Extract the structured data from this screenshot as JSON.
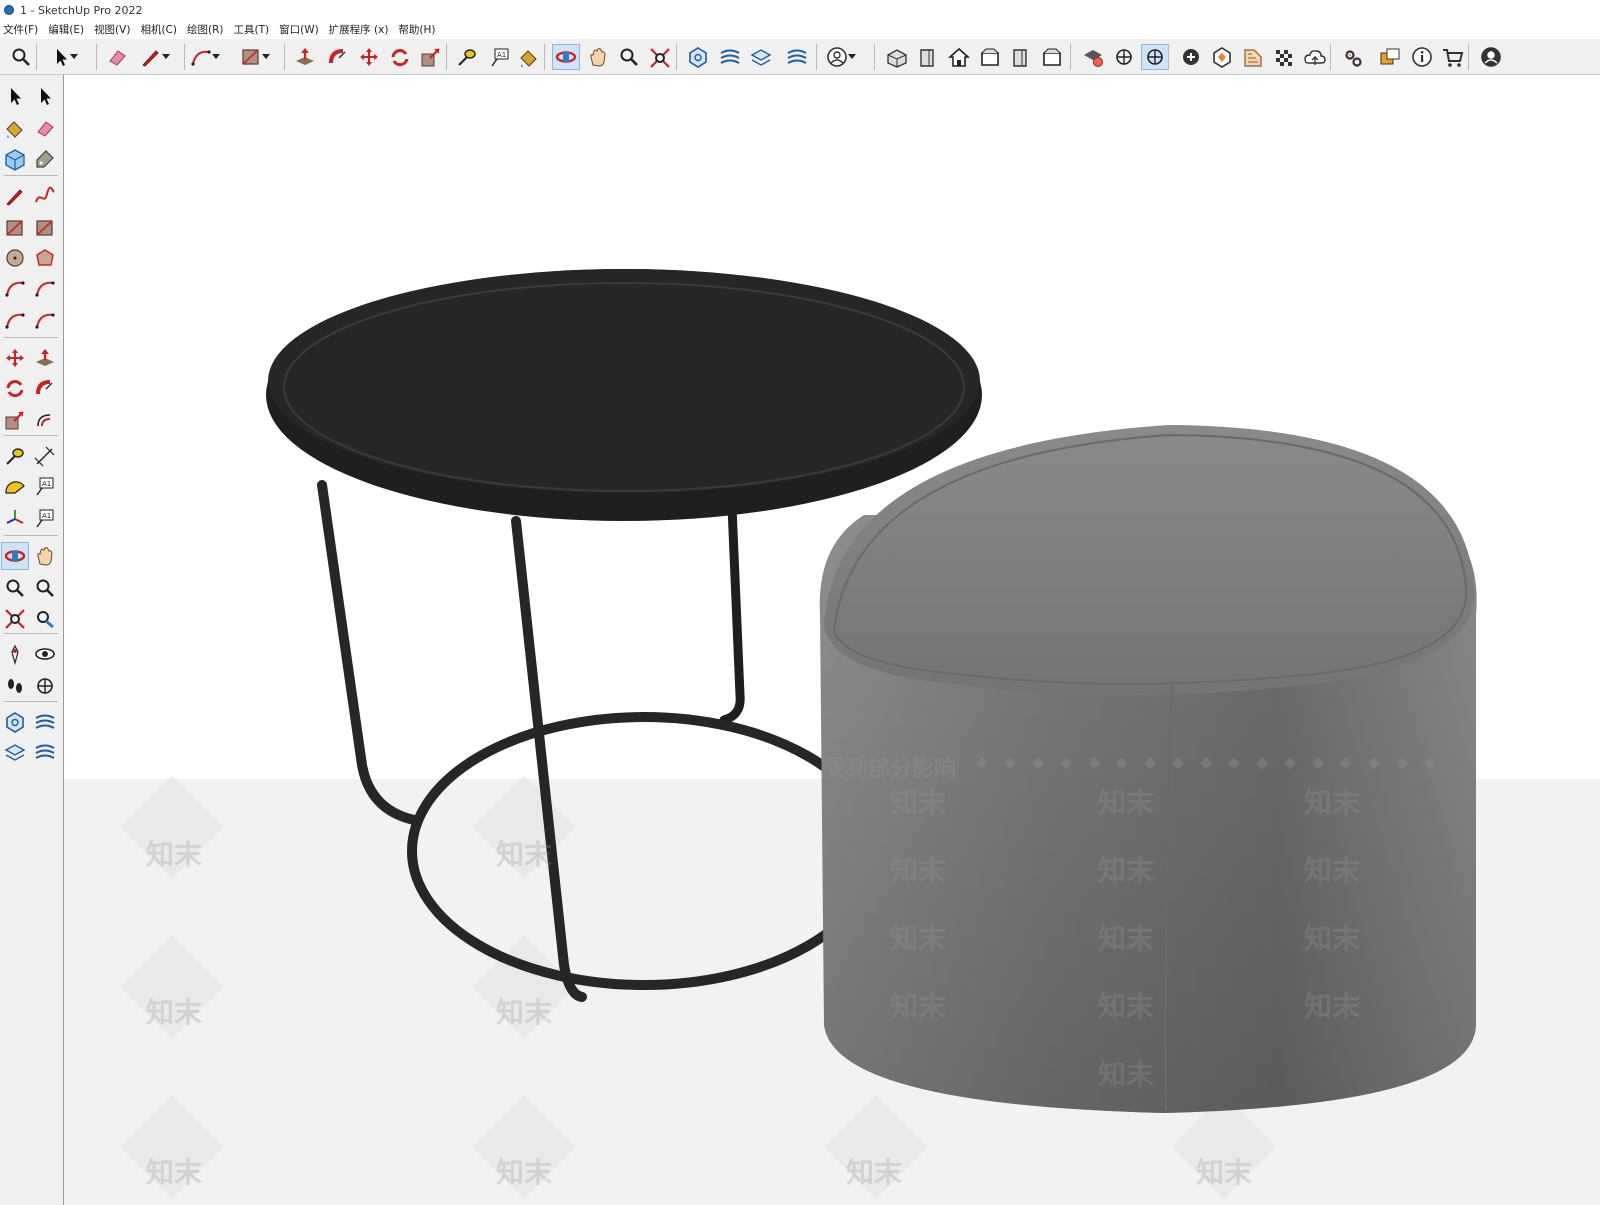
{
  "window": {
    "title": "1 - SketchUp Pro 2022"
  },
  "menu": [
    "文件(F)",
    "编辑(E)",
    "视图(V)",
    "相机(C)",
    "绘图(R)",
    "工具(T)",
    "窗口(W)",
    "扩展程序 (x)",
    "帮助(H)"
  ],
  "colors": {
    "toolbar_bg": "#f0f0f0",
    "table_black": "#262626",
    "ottoman_gray": "#7a7a7a",
    "ground": "#f2f2f2",
    "active_tool": "#cfe3f7"
  },
  "top_toolbar": [
    "search-icon",
    "select-icon",
    "eraser-icon",
    "pencil-line-icon",
    "arc-icon",
    "rectangle-icon",
    "push-pull-icon",
    "follow-me-icon",
    "move-icon",
    "rotate-icon",
    "scale-icon",
    "tape-measure-icon",
    "text-label-icon",
    "paint-bucket-icon",
    "orbit-icon",
    "pan-icon",
    "zoom-icon",
    "zoom-extents-icon",
    "warehouse-icon",
    "extension-warehouse-icon",
    "layout-icon",
    "extension-manager-icon",
    "user-account-icon",
    "iso-view-icon",
    "front-view-icon",
    "home-view-icon",
    "top-view-icon",
    "right-view-icon",
    "back-view-icon",
    "solid-check-icon",
    "section-plane-icon",
    "section-cut-icon",
    "add-location-icon",
    "sandbox-icon",
    "style-builder-icon",
    "checker-icon",
    "cloud-icon",
    "settings-icon",
    "dialog-icon",
    "info-icon",
    "cart-icon",
    "profile-icon"
  ],
  "left_toolbar": [
    "select-icon",
    "orbit-select-icon",
    "paint-bucket-icon",
    "eraser-icon",
    "component-icon",
    "tag-icon",
    "line-icon",
    "freehand-icon",
    "rectangle-icon",
    "rotated-rectangle-icon",
    "circle-icon",
    "polygon-icon",
    "arc-icon",
    "two-point-arc-icon",
    "three-point-arc-icon",
    "pie-icon",
    "move-icon",
    "push-pull-icon",
    "rotate-icon",
    "follow-me-icon",
    "scale-icon",
    "offset-icon",
    "tape-measure-icon",
    "dimension-icon",
    "protractor-icon",
    "text-icon",
    "axes-icon",
    "3d-text-icon",
    "orbit-icon",
    "pan-icon",
    "zoom-icon",
    "zoom-window-icon",
    "zoom-extents-icon",
    "previous-view-icon",
    "position-camera-icon",
    "look-around-icon",
    "walk-icon",
    "section-plane-icon",
    "warehouse-icon",
    "extension-warehouse-icon",
    "layout-icon",
    "extension-manager-icon"
  ],
  "watermark": {
    "banner": "受到部分影响",
    "text": "知末"
  }
}
